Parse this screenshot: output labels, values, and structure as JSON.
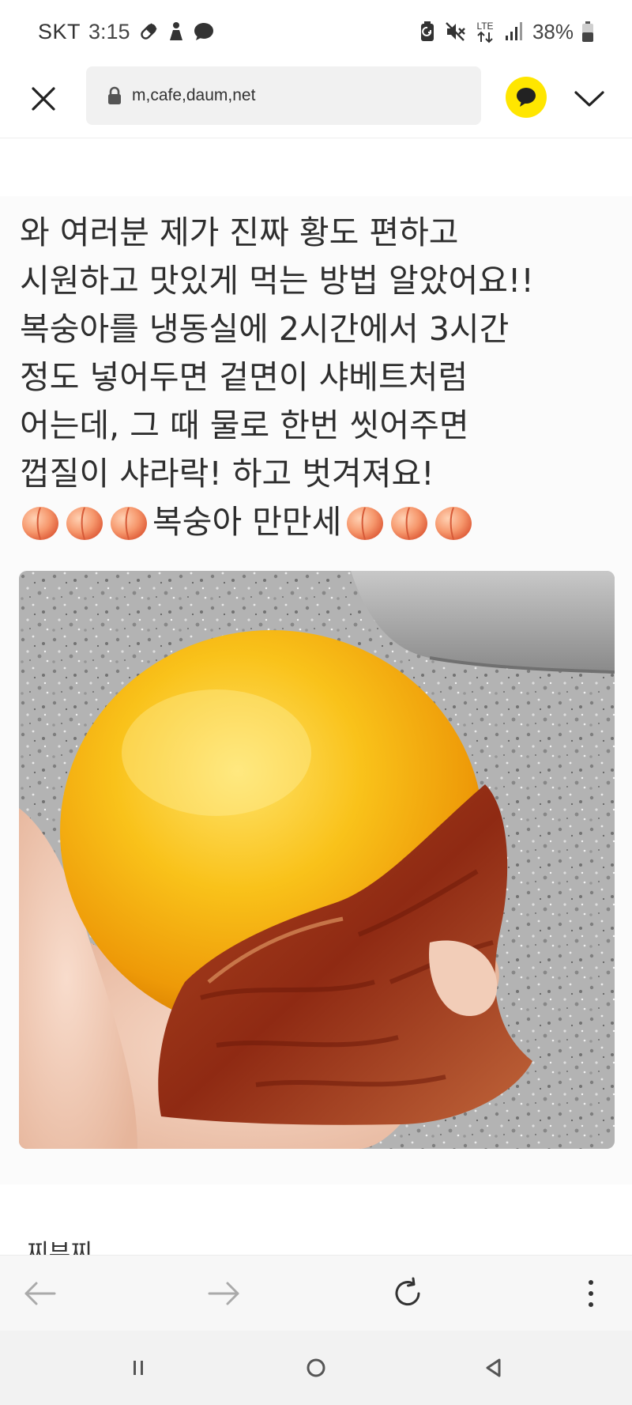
{
  "status_bar": {
    "carrier": "SKT",
    "time": "3:15",
    "network": "LTE",
    "battery": "38%",
    "icons_left": [
      "pill-icon",
      "person-icon",
      "chat-bubble-icon"
    ],
    "icons_right": [
      "battery-saver-icon",
      "mute-icon",
      "lte-icon",
      "signal-icon",
      "battery-icon"
    ]
  },
  "toolbar": {
    "url": "m,cafe,daum,net",
    "accent": "#ffe600"
  },
  "post": {
    "lines": [
      "와 여러분 제가 진짜 황도 편하고",
      "시원하고 맛있게 먹는 방법 알았어요!!",
      "복숭아를 냉동실에 2시간에서 3시간",
      "정도 넣어두면 겉면이 샤베트처럼",
      "어는데, 그 때 물로 한번 씻어주면",
      "껍질이 샤라락! 하고 벗겨져요!"
    ],
    "emoji_text": "복숭아 만만세",
    "emoji_name": "peach-emoji",
    "next_text": "찌부찌"
  },
  "bottom_bar": {
    "icons": [
      "back-arrow-icon",
      "forward-arrow-icon",
      "refresh-icon",
      "more-vert-icon"
    ]
  },
  "nav_bar": {
    "icons": [
      "recents-icon",
      "home-icon",
      "back-icon"
    ]
  }
}
